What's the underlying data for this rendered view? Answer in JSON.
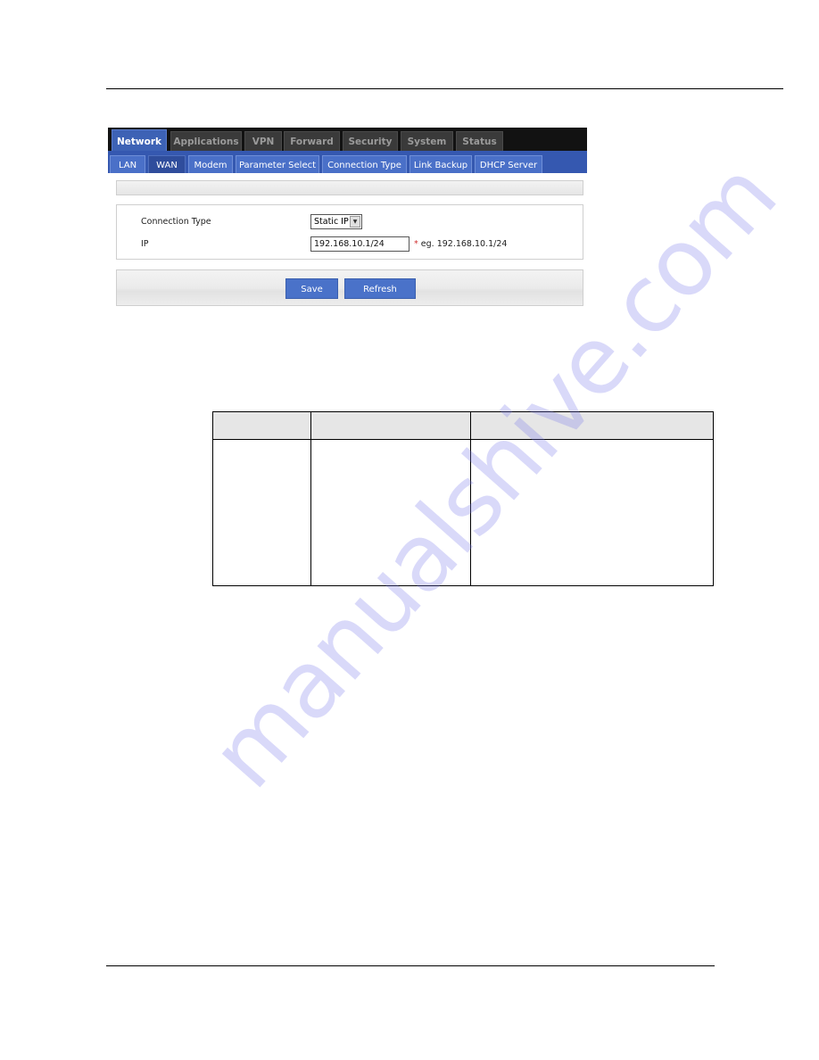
{
  "ui": {
    "main_tabs": [
      {
        "label": "Network",
        "active": true
      },
      {
        "label": "Applications",
        "active": false
      },
      {
        "label": "VPN",
        "active": false
      },
      {
        "label": "Forward",
        "active": false
      },
      {
        "label": "Security",
        "active": false
      },
      {
        "label": "System",
        "active": false
      },
      {
        "label": "Status",
        "active": false
      }
    ],
    "sub_tabs": [
      {
        "label": "LAN",
        "active": false
      },
      {
        "label": "WAN",
        "active": true
      },
      {
        "label": "Modem",
        "active": false
      },
      {
        "label": "Parameter Select",
        "active": false
      },
      {
        "label": "Connection Type",
        "active": false
      },
      {
        "label": "Link Backup",
        "active": false
      },
      {
        "label": "DHCP Server",
        "active": false
      }
    ],
    "form": {
      "connection_type_label": "Connection Type",
      "connection_type_value": "Static IP",
      "ip_label": "IP",
      "ip_value": "192.168.10.1/24",
      "required_mark": "*",
      "ip_hint": "eg. 192.168.10.1/24"
    },
    "buttons": {
      "save": "Save",
      "refresh": "Refresh"
    }
  },
  "table": {
    "headers": [
      "",
      "",
      ""
    ],
    "rows": [
      [
        "",
        "",
        ""
      ]
    ]
  },
  "watermark": "manualshive.com",
  "colors": {
    "active_tab": "#3d62b5",
    "subbar": "#3558b0",
    "button": "#4a72c9",
    "required": "#d03030",
    "watermark": "#7878eb"
  }
}
